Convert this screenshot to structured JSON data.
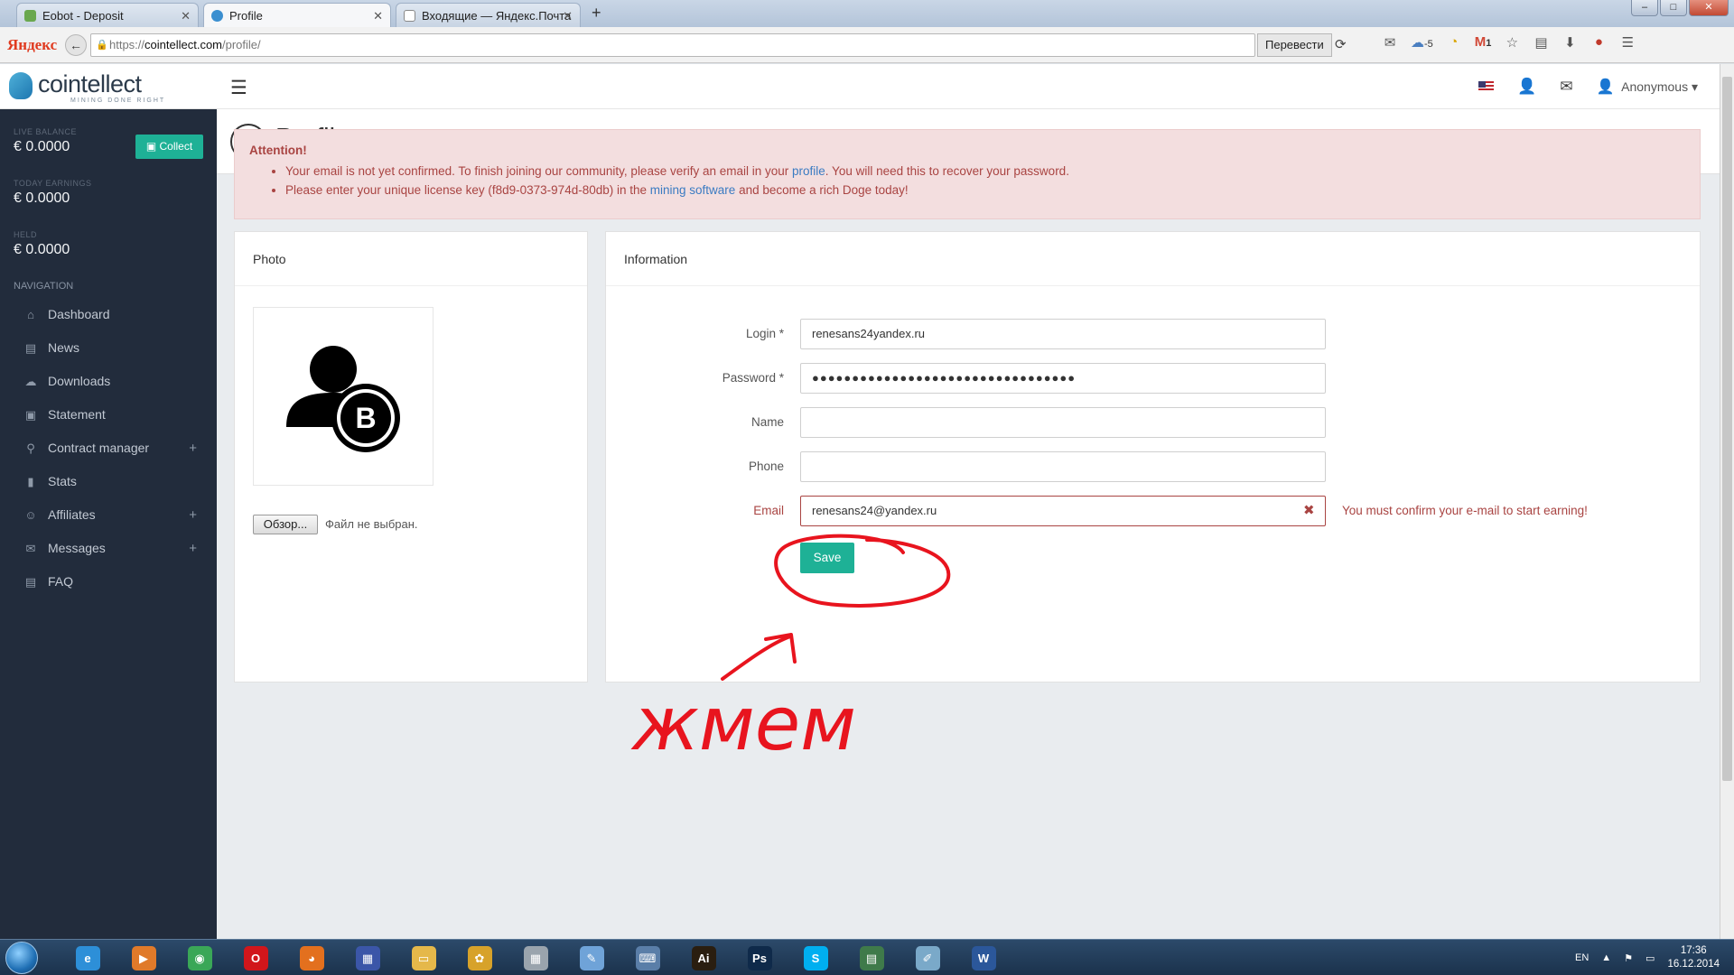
{
  "browser": {
    "tabs": [
      {
        "title": "Eobot - Deposit",
        "active": false
      },
      {
        "title": "Profile",
        "active": true
      },
      {
        "title": "Входящие — Яндекс.Почта",
        "active": false
      }
    ],
    "new_tab": "+",
    "window_controls": {
      "minimize": "–",
      "maximize": "□",
      "close": "✕"
    },
    "brand": "Яндекс",
    "url_scheme": "https://",
    "url_domain": "cointellect.com",
    "url_path": "/profile/",
    "translate_label": "Перевести",
    "weather": "-5",
    "mail_badge": "1"
  },
  "site": {
    "logo_text": "cointellect",
    "logo_sub": "MINING DONE RIGHT",
    "user_name": "Anonymous",
    "caret": "▾"
  },
  "balances": [
    {
      "label": "LIVE BALANCE",
      "value": "€ 0.0000"
    },
    {
      "label": "TODAY EARNINGS",
      "value": "€ 0.0000"
    },
    {
      "label": "HELD",
      "value": "€ 0.0000"
    }
  ],
  "collect_label": "Collect",
  "nav": {
    "heading": "NAVIGATION",
    "items": [
      {
        "label": "Dashboard",
        "icon": "⌂",
        "expandable": ""
      },
      {
        "label": "News",
        "icon": "▤",
        "expandable": ""
      },
      {
        "label": "Downloads",
        "icon": "☁",
        "expandable": ""
      },
      {
        "label": "Statement",
        "icon": "▣",
        "expandable": ""
      },
      {
        "label": "Contract manager",
        "icon": "⚲",
        "expandable": "+"
      },
      {
        "label": "Stats",
        "icon": "▮",
        "expandable": ""
      },
      {
        "label": "Affiliates",
        "icon": "☺",
        "expandable": "+"
      },
      {
        "label": "Messages",
        "icon": "✉",
        "expandable": "+"
      },
      {
        "label": "FAQ",
        "icon": "▤",
        "expandable": ""
      }
    ]
  },
  "page_title": "Profile",
  "alert": {
    "title": "Attention!",
    "line1_before": "Your email is not yet confirmed. To finish joining our community, please verify an email in your ",
    "line1_link": "profile",
    "line1_after": ". You will need this to recover your password.",
    "line2_before": "Please enter your unique license key (f8d9-0373-974d-80db) in the ",
    "line2_link": "mining software",
    "line2_after": " and become a rich Doge today!"
  },
  "photo_panel": {
    "title": "Photo",
    "browse_label": "Обзор...",
    "file_status": "Файл не выбран."
  },
  "info_panel": {
    "title": "Information",
    "fields": {
      "login": {
        "label": "Login *",
        "value": "renesans24yandex.ru"
      },
      "password": {
        "label": "Password *",
        "value": "●●●●●●●●●●●●●●●●●●●●●●●●●●●●●●●●●"
      },
      "name": {
        "label": "Name",
        "value": ""
      },
      "phone": {
        "label": "Phone",
        "value": ""
      },
      "email": {
        "label": "Email",
        "value": "renesans24@yandex.ru",
        "error": "You must confirm your e-mail to start earning!"
      }
    },
    "save_label": "Save"
  },
  "annotation_text": "жмем",
  "annotation_color": "#e8141e",
  "taskbar": {
    "lang": "EN",
    "time": "17:36",
    "date": "16.12.2014",
    "apps": [
      {
        "name": "internet-explorer",
        "glyph": "e",
        "color": "#2d8fd8"
      },
      {
        "name": "media-player",
        "glyph": "▶",
        "color": "#e07a2a"
      },
      {
        "name": "chrome",
        "glyph": "◉",
        "color": "#3aa757"
      },
      {
        "name": "opera",
        "glyph": "O",
        "color": "#d1161b"
      },
      {
        "name": "firefox",
        "glyph": "◕",
        "color": "#e3701e"
      },
      {
        "name": "save-app",
        "glyph": "▦",
        "color": "#3b56a8"
      },
      {
        "name": "explorer",
        "glyph": "▭",
        "color": "#e5b84a"
      },
      {
        "name": "tool-app",
        "glyph": "✿",
        "color": "#d7a22a"
      },
      {
        "name": "calculator",
        "glyph": "▦",
        "color": "#9aa4ad"
      },
      {
        "name": "paint",
        "glyph": "✎",
        "color": "#6fa3d8"
      },
      {
        "name": "keyboard-app",
        "glyph": "⌨",
        "color": "#5a7ea8"
      },
      {
        "name": "illustrator",
        "glyph": "Ai",
        "color": "#2a1e10"
      },
      {
        "name": "photoshop",
        "glyph": "Ps",
        "color": "#0f2a4a"
      },
      {
        "name": "skype",
        "glyph": "S",
        "color": "#00aff0"
      },
      {
        "name": "monitor-app",
        "glyph": "▤",
        "color": "#3f7a4a"
      },
      {
        "name": "notes-app",
        "glyph": "✐",
        "color": "#7aa9c9"
      },
      {
        "name": "word",
        "glyph": "W",
        "color": "#2b579a"
      }
    ]
  }
}
